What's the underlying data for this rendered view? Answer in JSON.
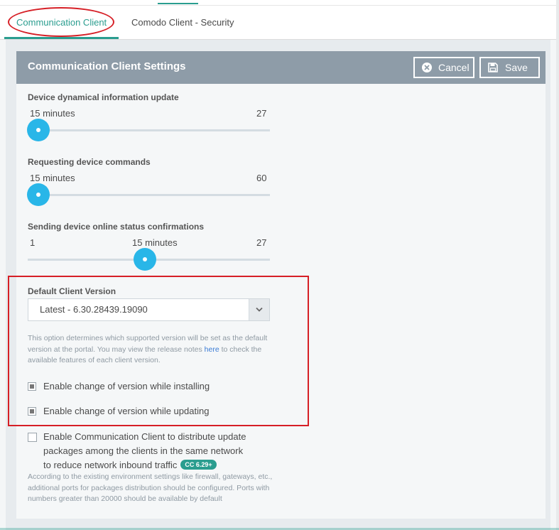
{
  "tabs": [
    {
      "label": "Communication Client",
      "active": true
    },
    {
      "label": "Comodo Client - Security",
      "active": false
    }
  ],
  "card": {
    "title": "Communication Client Settings",
    "cancel_label": "Cancel",
    "save_label": "Save"
  },
  "settings": [
    {
      "label": "Device dynamical information update",
      "min_label": "",
      "current_label": "15 minutes",
      "max_label": "27",
      "position": 0.0
    },
    {
      "label": "Requesting device commands",
      "min_label": "",
      "current_label": "15 minutes",
      "max_label": "60",
      "position": 0.0
    },
    {
      "label": "Sending device online status confirmations",
      "min_label": "1",
      "current_label": "15 minutes",
      "max_label": "27",
      "position": 0.5
    }
  ],
  "version": {
    "label": "Default Client Version",
    "selected": "Latest - 6.30.28439.19090",
    "help_before_link": "This option determines which supported version will be set as the default version at the portal. You may view the release notes ",
    "help_link": "here",
    "help_after_link": " to check the available features of each client version."
  },
  "checkboxes": [
    {
      "label": "Enable change of version while installing",
      "checked": true
    },
    {
      "label": "Enable change of version while updating",
      "checked": true
    }
  ],
  "distribute": {
    "line1": "Enable Communication Client to distribute update",
    "line2": "packages among the clients in the same network",
    "line3": "to reduce network inbound traffic",
    "checked": false,
    "badge": "CC 6.29+",
    "help": "According to the existing environment settings like firewall, gateways, etc., additional ports for packages distribution should be configured. Ports with numbers greater than 20000 should be available by default"
  },
  "icons": {
    "cancel": "x-circle-icon",
    "save": "floppy-disk-icon",
    "dropdown": "chevron-down-icon"
  },
  "colors": {
    "accent": "#2a9d8f",
    "header": "#8e9ca8",
    "slider": "#29b6e8",
    "highlight": "#d61f26"
  }
}
